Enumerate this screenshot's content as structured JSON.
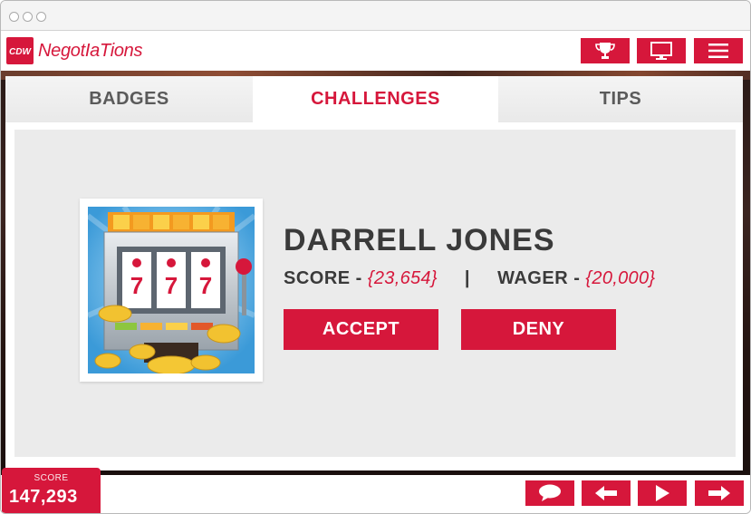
{
  "window": {
    "controls": [
      "close",
      "minimize",
      "maximize"
    ]
  },
  "header": {
    "logo_text": "CDW",
    "brand": "NegotIaTions",
    "buttons": [
      {
        "icon": "trophy-icon"
      },
      {
        "icon": "monitor-icon"
      },
      {
        "icon": "menu-icon"
      }
    ]
  },
  "tabs": [
    {
      "label": "BADGES",
      "active": false
    },
    {
      "label": "CHALLENGES",
      "active": true
    },
    {
      "label": "TIPS",
      "active": false
    }
  ],
  "challenge": {
    "name": "DARRELL JONES",
    "score_label": "SCORE -",
    "score_value": "{23,654}",
    "separator": "|",
    "wager_label": "WAGER -",
    "wager_value": "{20,000}",
    "accept_label": "ACCEPT",
    "deny_label": "DENY"
  },
  "footer": {
    "score_label": "SCORE",
    "score_value": "147,293",
    "buttons": [
      {
        "icon": "chat-icon"
      },
      {
        "icon": "arrow-left-icon"
      },
      {
        "icon": "play-icon"
      },
      {
        "icon": "arrow-right-icon"
      }
    ]
  },
  "colors": {
    "accent": "#d6173b",
    "text": "#3a3a3a",
    "panel": "#ebebeb"
  }
}
